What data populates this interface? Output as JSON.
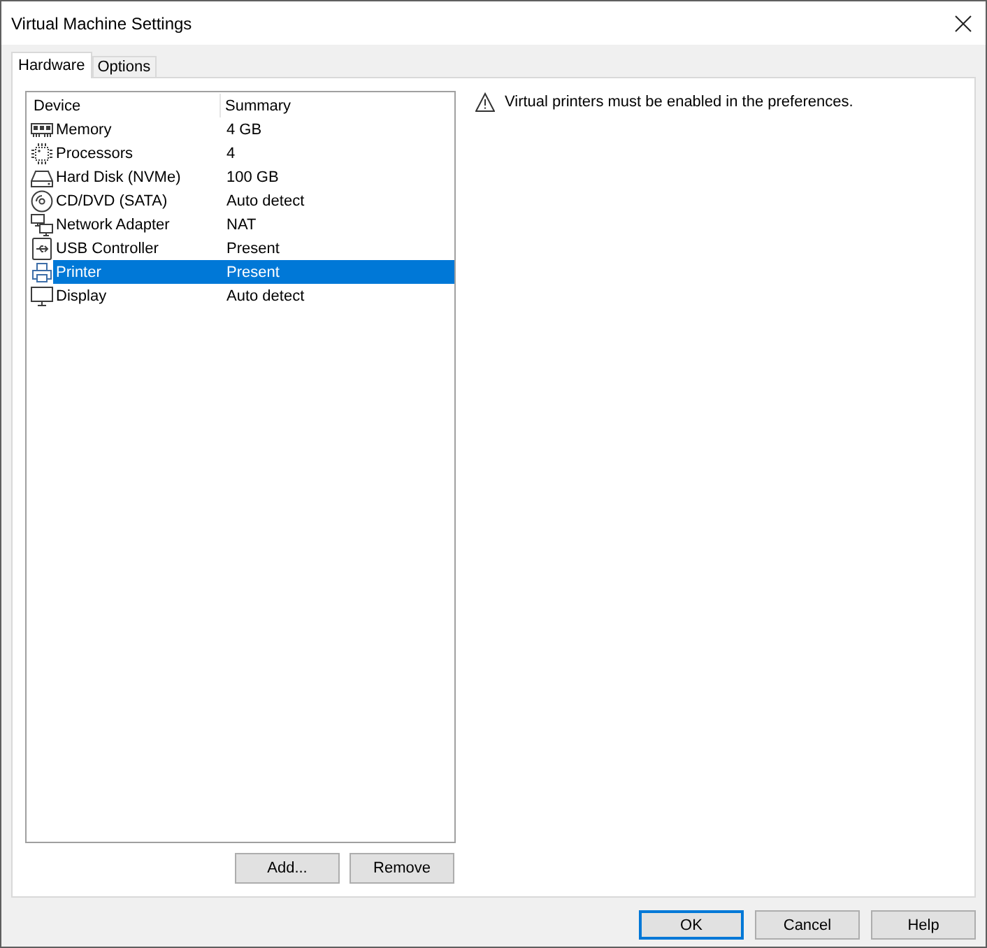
{
  "window": {
    "title": "Virtual Machine Settings"
  },
  "tabs": [
    {
      "label": "Hardware",
      "selected": true
    },
    {
      "label": "Options",
      "selected": false
    }
  ],
  "device_table": {
    "columns": [
      "Device",
      "Summary"
    ],
    "rows": [
      {
        "kind": "memory",
        "device": "Memory",
        "summary": "4 GB",
        "selected": false
      },
      {
        "kind": "processor",
        "device": "Processors",
        "summary": "4",
        "selected": false
      },
      {
        "kind": "disk",
        "device": "Hard Disk (NVMe)",
        "summary": "100 GB",
        "selected": false
      },
      {
        "kind": "cd",
        "device": "CD/DVD (SATA)",
        "summary": "Auto detect",
        "selected": false
      },
      {
        "kind": "network",
        "device": "Network Adapter",
        "summary": "NAT",
        "selected": false
      },
      {
        "kind": "usb",
        "device": "USB Controller",
        "summary": "Present",
        "selected": false
      },
      {
        "kind": "printer",
        "device": "Printer",
        "summary": "Present",
        "selected": true
      },
      {
        "kind": "display",
        "device": "Display",
        "summary": "Auto detect",
        "selected": false
      }
    ]
  },
  "device_buttons": [
    "Add...",
    "Remove"
  ],
  "message": {
    "text": "Virtual printers must be enabled in the preferences."
  },
  "buttons": [
    {
      "label": "OK",
      "default": true
    },
    {
      "label": "Cancel",
      "default": false
    },
    {
      "label": "Help",
      "default": false
    }
  ]
}
